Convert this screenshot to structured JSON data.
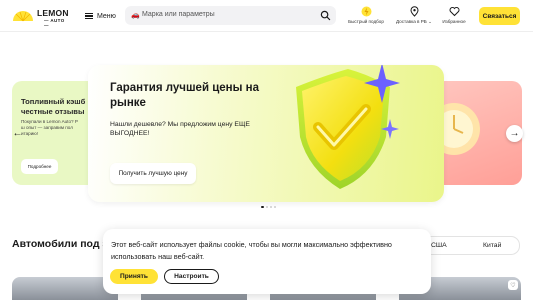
{
  "header": {
    "logo_text": "LEMON",
    "logo_sub": "— AUTO —",
    "menu_label": "Меню",
    "search_placeholder": "Марка или параметры",
    "nav": [
      {
        "label": "Быстрый подбор",
        "icon": "lightning-icon"
      },
      {
        "label": "Доставка в РБ",
        "icon": "location-pin-icon"
      },
      {
        "label": "Избранное",
        "icon": "heart-icon"
      }
    ],
    "delivery_chevron": "⌄",
    "cta_label": "Связаться"
  },
  "carousel": {
    "left_card": {
      "title_line1": "Топливный кэшб",
      "title_line2": "честные отзывы",
      "text_line1": "Покупали в Lemon Auto? Р",
      "text_line2": "ш опыт — заправим пол",
      "text_line3": "итарию!",
      "button": "Подробнее"
    },
    "main_card": {
      "title": "Гарантия лучшей цены на рынке",
      "description": "Нашли дешевле? Мы предложим цену ЕЩЕ ВЫГОДНЕЕ!",
      "button": "Получить лучшую цену"
    },
    "prev_arrow": "←",
    "next_arrow": "→",
    "slide_count": 4,
    "active_slide": 1
  },
  "section": {
    "title": "Автомобили под за",
    "filters": [
      "США",
      "Китай"
    ]
  },
  "cookie": {
    "text": "Этот веб-сайт использует файлы cookie, чтобы вы могли максимально эффективно использовать наш веб-сайт.",
    "accept": "Принять",
    "configure": "Настроить"
  },
  "colors": {
    "accent_yellow": "#ffe236",
    "main_card_green": "#eaf58a",
    "left_card_green": "#e9f8c4",
    "right_card_pink": "#ff9f97"
  }
}
